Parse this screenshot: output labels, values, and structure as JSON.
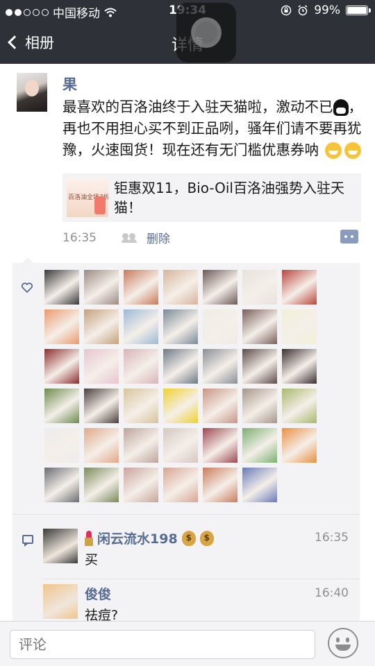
{
  "status_bar": {
    "carrier": "中国移动",
    "time": "19:34",
    "battery": "99%",
    "battery_level": 0.99
  },
  "nav": {
    "back_label": "相册",
    "title": "详情"
  },
  "post": {
    "author": "果",
    "text_1": "最喜欢的百洛油终于入驻天猫啦，激动不已",
    "text_2": "，再也不用担心买不到正品咧，骚年们请不要再犹豫，火速囤货！现在还有无门槛优惠券呐",
    "link_thumb_text": "百洛油全场7折",
    "link_title": "钜惠双11，Bio-Oil百洛油强势入驻天猫！",
    "time": "16:35",
    "delete_label": "删除"
  },
  "likes": {
    "avatars": [
      "#3a3a3a",
      "#9a8a84",
      "#c77a5a",
      "#d6b49c",
      "#6b5a58",
      "#e8e2dc",
      "#b8463c",
      "#e99a6c",
      "#c4a07a",
      "#9cb9d6",
      "#7a8a98",
      "#f0ece6",
      "#7a5e5a",
      "#f2f0d8",
      "#8c2c2c",
      "#e8c4d0",
      "#d8b4b8",
      "#6c7a86",
      "#8a8e96",
      "#5c4a48",
      "#3c2e30",
      "#6c8a4c",
      "#4a3e3c",
      "#d8c49c",
      "#f0d030",
      "#c89486",
      "#a4968a",
      "#a8b86c",
      "#ececec",
      "#e0a888",
      "#bca49c",
      "#d4c8c0",
      "#9c4850",
      "#7ab070",
      "#e89040",
      "#6a6c72",
      "#7a8a5a",
      "#c8a49c",
      "#d8a494",
      "#c87c5c",
      "#6a7ab8"
    ]
  },
  "comments": [
    {
      "name": "闲云流水198",
      "time": "16:35",
      "text": "买",
      "avatar_color": "#3a3a3a"
    },
    {
      "name": "俊俊",
      "time": "16:40",
      "text": "祛痘?",
      "avatar_color": "#f2c48c"
    }
  ],
  "input": {
    "placeholder": "评论"
  },
  "colors": {
    "nav_bg": "#2e3238",
    "link_blue": "#576b95",
    "panel_bg": "#f3f3f5"
  }
}
